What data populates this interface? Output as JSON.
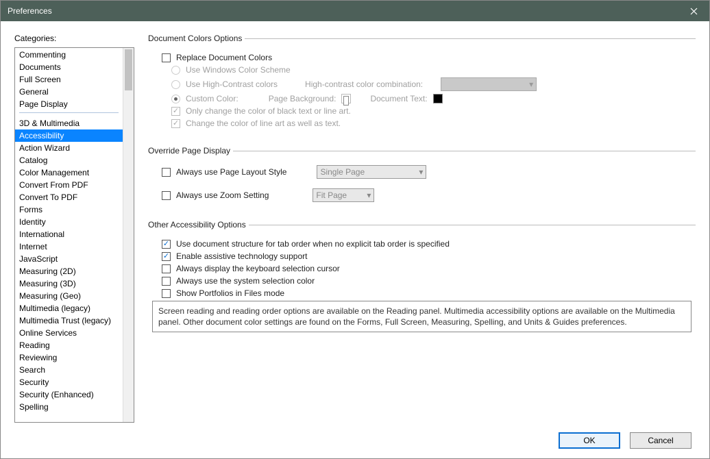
{
  "window": {
    "title": "Preferences"
  },
  "sidebar": {
    "label": "Categories:",
    "group1": [
      "Commenting",
      "Documents",
      "Full Screen",
      "General",
      "Page Display"
    ],
    "group2": [
      "3D & Multimedia",
      "Accessibility",
      "Action Wizard",
      "Catalog",
      "Color Management",
      "Convert From PDF",
      "Convert To PDF",
      "Forms",
      "Identity",
      "International",
      "Internet",
      "JavaScript",
      "Measuring (2D)",
      "Measuring (3D)",
      "Measuring (Geo)",
      "Multimedia (legacy)",
      "Multimedia Trust (legacy)",
      "Online Services",
      "Reading",
      "Reviewing",
      "Search",
      "Security",
      "Security (Enhanced)",
      "Spelling"
    ],
    "selected": "Accessibility"
  },
  "doc_colors": {
    "legend": "Document Colors Options",
    "replace": "Replace Document Colors",
    "use_windows": "Use Windows Color Scheme",
    "use_hc": "Use High-Contrast colors",
    "hc_label": "High-contrast color combination:",
    "custom": "Custom Color:",
    "page_bg": "Page Background:",
    "doc_text": "Document Text:",
    "only_black": "Only change the color of black text or line art.",
    "change_lineart": "Change the color of line art as well as text."
  },
  "override": {
    "legend": "Override Page Display",
    "layout_ck": "Always use Page Layout Style",
    "layout_val": "Single Page",
    "zoom_ck": "Always use Zoom Setting",
    "zoom_val": "Fit Page"
  },
  "other": {
    "legend": "Other Accessibility Options",
    "tab_order": "Use document structure for tab order when no explicit tab order is specified",
    "assistive": "Enable assistive technology support",
    "kb_cursor": "Always display the keyboard selection cursor",
    "sys_sel": "Always use the system selection color",
    "portfolios": "Show Portfolios in Files mode",
    "note": "Screen reading and reading order options are available on the Reading panel. Multimedia accessibility options are available on the Multimedia panel. Other document color settings are found on the Forms, Full Screen, Measuring, Spelling, and Units & Guides preferences."
  },
  "footer": {
    "ok": "OK",
    "cancel": "Cancel"
  }
}
